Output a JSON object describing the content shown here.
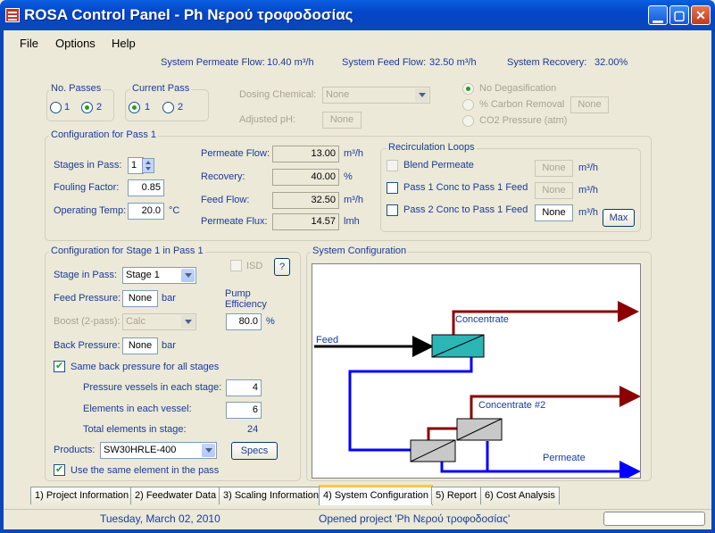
{
  "window": {
    "title": "ROSA Control Panel - Ph Νερού τροφοδοσίας"
  },
  "menu": [
    "File",
    "Options",
    "Help"
  ],
  "summary": {
    "permeate_flow_label": "System Permeate Flow:",
    "permeate_flow_value": "10.40 m³/h",
    "feed_flow_label": "System Feed Flow:",
    "feed_flow_value": "32.50 m³/h",
    "recovery_label": "System Recovery:",
    "recovery_value": "32.00%"
  },
  "passes": {
    "no_passes_title": "No. Passes",
    "no_passes_options": [
      "1",
      "2"
    ],
    "no_passes_selected": "2",
    "current_pass_title": "Current Pass",
    "current_pass_options": [
      "1",
      "2"
    ],
    "current_pass_selected": "1"
  },
  "dosing": {
    "chemical_label": "Dosing Chemical:",
    "chemical_value": "None",
    "adjusted_ph_label": "Adjusted pH:",
    "adjusted_ph_value": "None"
  },
  "degas": {
    "options": [
      "No Degasification",
      "% Carbon Removal",
      "CO2 Pressure (atm)"
    ],
    "selected": "No Degasification",
    "value": "None"
  },
  "pass_config": {
    "title": "Configuration for Pass 1",
    "stages_label": "Stages in Pass:",
    "stages_value": "1",
    "fouling_label": "Fouling Factor:",
    "fouling_value": "0.85",
    "temp_label": "Operating Temp:",
    "temp_value": "20.0",
    "temp_unit": "°C",
    "permeate_flow_label": "Permeate Flow:",
    "permeate_flow_value": "13.00",
    "permeate_flow_unit": "m³/h",
    "recovery_label": "Recovery:",
    "recovery_value": "40.00",
    "recovery_unit": "%",
    "feed_flow_label": "Feed Flow:",
    "feed_flow_value": "32.50",
    "feed_flow_unit": "m³/h",
    "flux_label": "Permeate Flux:",
    "flux_value": "14.57",
    "flux_unit": "lmh"
  },
  "recirc": {
    "title": "Recirculation Loops",
    "unit": "m³/h",
    "rows": [
      {
        "label": "Blend Permeate",
        "value": "None",
        "disabled": true
      },
      {
        "label": "Pass 1 Conc to Pass 1 Feed",
        "value": "None",
        "disabled": true
      },
      {
        "label": "Pass 2 Conc to Pass 1 Feed",
        "value": "None",
        "disabled": false
      }
    ],
    "max_button": "Max"
  },
  "stage_config": {
    "title": "Configuration for Stage 1 in Pass 1",
    "isd_label": "ISD",
    "help_button": "?",
    "stage_label": "Stage in Pass:",
    "stage_value": "Stage 1",
    "feed_pressure_label": "Feed Pressure:",
    "feed_pressure_value": "None",
    "pressure_unit": "bar",
    "pump_eff_label": "Pump Efficiency",
    "pump_eff_value": "80.0",
    "pump_eff_unit": "%",
    "boost_label": "Boost (2-pass):",
    "boost_value": "Calc",
    "back_pressure_label": "Back Pressure:",
    "back_pressure_value": "None",
    "same_back_pressure_label": "Same back pressure for all stages",
    "vessels_label": "Pressure vessels in each stage:",
    "vessels_value": "4",
    "elements_label": "Elements in each vessel:",
    "elements_value": "6",
    "total_label": "Total elements in stage:",
    "total_value": "24",
    "products_label": "Products:",
    "products_value": "SW30HRLE-400",
    "specs_button": "Specs",
    "same_element_label": "Use the same element in the pass"
  },
  "system_config": {
    "title": "System Configuration",
    "feed_label": "Feed",
    "concentrate_label": "Concentrate",
    "concentrate2_label": "Concentrate #2",
    "permeate_label": "Permeate"
  },
  "tabs": [
    "1) Project Information",
    "2) Feedwater Data",
    "3) Scaling Information",
    "4) System Configuration",
    "5) Report",
    "6) Cost Analysis"
  ],
  "active_tab": "4) System Configuration",
  "status": {
    "date": "Tuesday, March 02, 2010",
    "message": "Opened project 'Ph Νερού τροφοδοσίας'"
  },
  "colors": {
    "titlebar": "#0346c9",
    "label_blue": "#1a3a9a",
    "concentrate": "#8b0000",
    "permeate": "#0000ff",
    "vessel1": "#2bb5b5",
    "vessel2": "#c8c8c8"
  }
}
